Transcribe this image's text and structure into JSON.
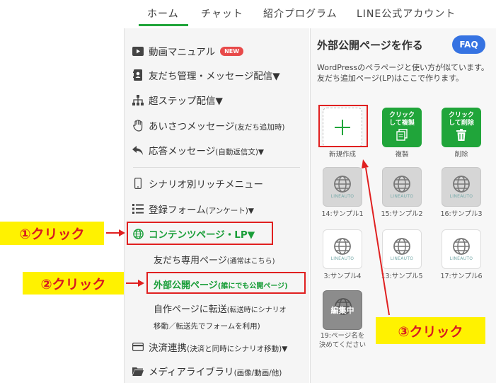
{
  "nav": {
    "tabs": [
      "ホーム",
      "チャット",
      "紹介プログラム",
      "LINE公式アカウント"
    ]
  },
  "sidebar": {
    "items": [
      {
        "label": "動画マニュアル",
        "badge": "NEW",
        "icon": "video-icon"
      },
      {
        "label": "友だち管理・メッセージ配信▼",
        "icon": "address-book-icon"
      },
      {
        "label": "超ステップ配信▼",
        "icon": "sitemap-icon"
      },
      {
        "label": "あいさつメッセージ",
        "small": "(友だち追加時)",
        "icon": "hand-icon"
      },
      {
        "label": "応答メッセージ",
        "small": "(自動返信文)▼",
        "icon": "reply-icon"
      },
      {
        "label": "シナリオ別リッチメニュー",
        "icon": "mobile-icon"
      },
      {
        "label": "登録フォーム",
        "small": "(アンケート)▼",
        "icon": "list-icon"
      },
      {
        "label": "コンテンツページ・LP▼",
        "icon": "globe-icon"
      },
      {
        "label": "決済連携",
        "small": "(決済と同時にシナリオ移動)▼",
        "icon": "credit-card-icon"
      },
      {
        "label": "メディアライブラリ",
        "small": "(画像/動画/他)",
        "icon": "folder-icon"
      }
    ],
    "subitems": {
      "friends_page": {
        "label": "友だち専用ページ",
        "small": "(通常はこちら)"
      },
      "public_page": {
        "label": "外部公開ページ",
        "small": "(誰にでも公開ページ)"
      },
      "transfer": {
        "line1": "自作ページに転送",
        "line1_small": "(転送時にシナリオ",
        "line2": "移動／転送先でフォームを利用)"
      }
    }
  },
  "panel": {
    "title": "外部公開ページを作る",
    "faq": "FAQ",
    "desc": "WordPressのぺラページと使い方が似ています。友だち追加ページ(LP)はここで作ります。",
    "new_label": "新規作成",
    "copy": {
      "text1": "クリック",
      "text2": "して複製",
      "label": "複製"
    },
    "delete": {
      "text1": "クリック",
      "text2": "して削除",
      "label": "削除"
    },
    "logo_text": "LINEAUTO",
    "pages": [
      {
        "label": "14:サンプル1",
        "state": "gray"
      },
      {
        "label": "15:サンプル2",
        "state": "gray"
      },
      {
        "label": "16:サンプル3",
        "state": "gray"
      },
      {
        "label": "3:サンプル4",
        "state": "white"
      },
      {
        "label": "13:サンプル5",
        "state": "white"
      },
      {
        "label": "17:サンプル6",
        "state": "white"
      },
      {
        "label1": "19:ページ名を",
        "label2": "決めてください",
        "state": "editing",
        "overlay": "編集中"
      }
    ]
  },
  "callouts": {
    "c1": "①クリック",
    "c2": "②クリック",
    "c3": "③クリック"
  },
  "colors": {
    "accent": "#20a53a",
    "callout_bg": "#fff200",
    "callout_text": "#d71921",
    "highlight": "#e02020",
    "faq": "#3673e2"
  }
}
